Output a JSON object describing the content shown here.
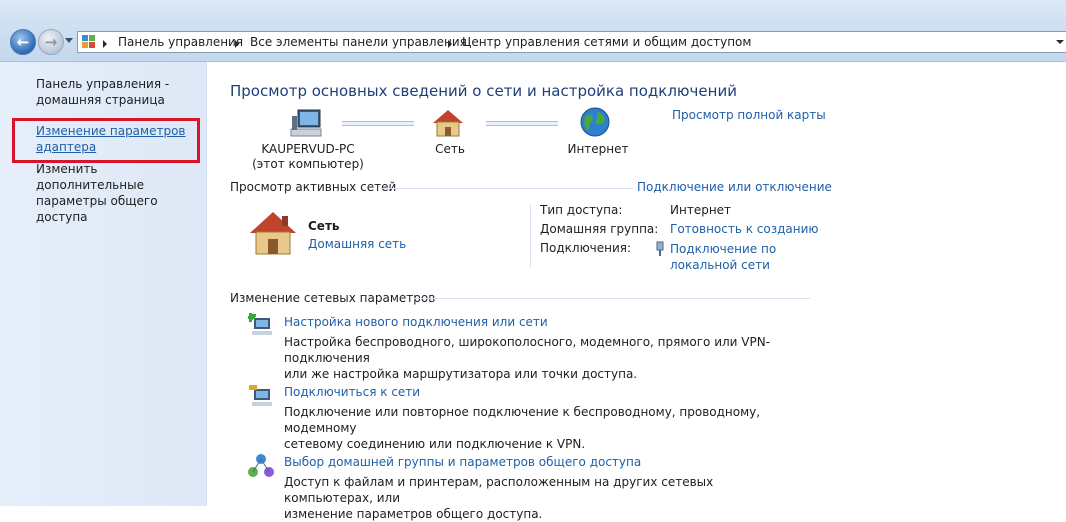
{
  "breadcrumbs": [
    "Панель управления",
    "Все элементы панели управления",
    "Центр управления сетями и общим доступом"
  ],
  "sidebar": {
    "home": "Панель управления - домашняя страница",
    "home_line1": "Панель управления -",
    "home_line2": "домашняя страница",
    "adapter_line1": "Изменение параметров",
    "adapter_line2": "адаптера",
    "sharing_line1": "Изменить дополнительные",
    "sharing_line2": "параметры общего доступа"
  },
  "main": {
    "title": "Просмотр основных сведений о сети и настройка подключений",
    "full_map_link": "Просмотр полной карты",
    "map": {
      "computer_name": "KAUPERVUD-PC",
      "computer_sub": "(этот компьютер)",
      "network": "Сеть",
      "internet": "Интернет"
    },
    "active_networks": {
      "header": "Просмотр активных сетей",
      "connect_link": "Подключение или отключение",
      "network_name": "Сеть",
      "network_type": "Домашняя сеть",
      "access_type_label": "Тип доступа:",
      "access_type_value": "Интернет",
      "homegroup_label": "Домашняя группа:",
      "homegroup_value": "Готовность к созданию",
      "connections_label": "Подключения:",
      "connection_line1": "Подключение по",
      "connection_line2": "локальной сети"
    },
    "change_settings": {
      "header": "Изменение сетевых параметров",
      "tasks": [
        {
          "title": "Настройка нового подключения или сети",
          "desc_line1": "Настройка беспроводного, широкополосного, модемного, прямого или VPN-подключения",
          "desc_line2": "или же настройка маршрутизатора или точки доступа."
        },
        {
          "title": "Подключиться к сети",
          "desc_line1": "Подключение или повторное подключение к беспроводному, проводному, модемному",
          "desc_line2": "сетевому соединению или подключение к VPN."
        },
        {
          "title": "Выбор домашней группы и параметров общего доступа",
          "desc_line1": "Доступ к файлам и принтерам, расположенным на других сетевых компьютерах, или",
          "desc_line2": "изменение параметров общего доступа."
        }
      ]
    }
  },
  "colors": {
    "link": "#1e5fa8",
    "title": "#1e3f7a",
    "highlight": "#d8142a"
  }
}
